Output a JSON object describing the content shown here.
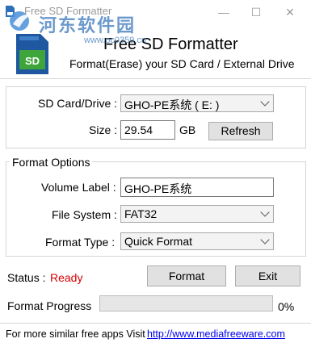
{
  "window": {
    "title": "Free SD Formatter",
    "minimize_glyph": "—",
    "maximize_glyph": "☐",
    "close_glyph": "✕"
  },
  "watermark": {
    "cn_text": "河东软件园",
    "url_text": "www.pc0359.cn"
  },
  "header": {
    "logo_text": "SD",
    "title": "Free SD Formatter",
    "subtitle": "Format(Erase) your SD Card / External Drive"
  },
  "drive": {
    "sd_card_label": "SD Card/Drive :",
    "sd_card_value": "GHO-PE系统 ( E: )",
    "size_label": "Size :",
    "size_value": "29.54",
    "size_unit": "GB",
    "refresh_label": "Refresh"
  },
  "format_options": {
    "legend": "Format Options",
    "volume_label_label": "Volume Label :",
    "volume_label_value": "GHO-PE系统",
    "file_system_label": "File System :",
    "file_system_value": "FAT32",
    "format_type_label": "Format Type :",
    "format_type_value": "Quick Format"
  },
  "status": {
    "label": "Status :",
    "value": "Ready",
    "value_color": "#d40000"
  },
  "actions": {
    "format_label": "Format",
    "exit_label": "Exit"
  },
  "progress": {
    "label": "Format Progress",
    "percent_text": "0%",
    "fraction": 0
  },
  "footer": {
    "text": "For more similar free apps Visit",
    "link": "http://www.mediafreeware.com"
  }
}
